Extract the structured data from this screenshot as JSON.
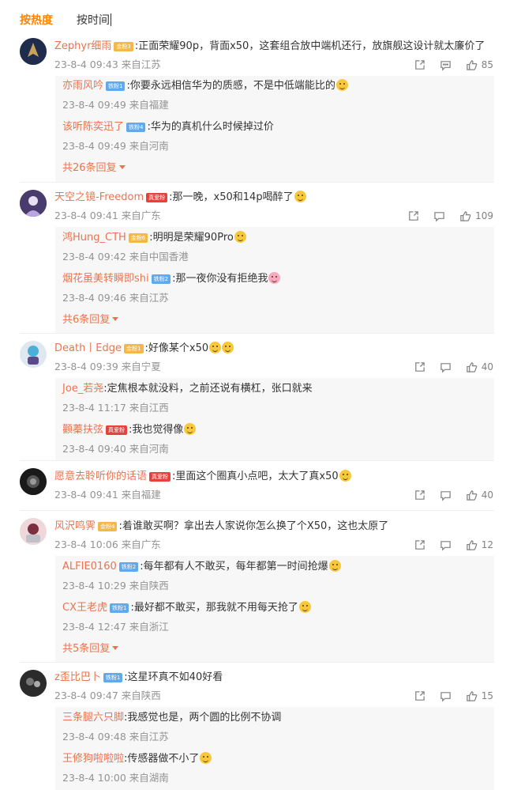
{
  "tabs": {
    "hot": "按热度",
    "time": "按时间"
  },
  "comments": [
    {
      "user": "Zephyr细雨",
      "badge": "金粉3",
      "badge_color": "#f6b74a",
      "text": ":正面荣耀90p，背面x50，这套组合放中端机还行，放旗舰这设计就太廉价了",
      "meta": "23-8-4 09:43 来自江苏",
      "likes": "85",
      "replies": [
        {
          "user": "亦雨风吟",
          "badge": "铁粉1",
          "text": ":你要永远相信华为的质感，不是中低端能比的",
          "meta": "23-8-4 09:49 来自福建"
        },
        {
          "user": "该听陈奕迅了",
          "badge": "铁粉4",
          "text": ":华为的真机什么时候掉过价",
          "meta": "23-8-4 09:49 来自河南"
        }
      ],
      "more": "共26条回复"
    },
    {
      "user": "天空之镜-Freedom",
      "badge": "真爱粉",
      "badge_color": "#e8413c",
      "text": ":那一晚，x50和14p喝醉了",
      "meta": "23-8-4 09:41 来自广东",
      "likes": "109",
      "replies": [
        {
          "user": "鸿Hung_CTH",
          "badge": "金粉6",
          "text": ":明明是荣耀90Pro",
          "meta": "23-8-4 09:42 来自中国香港"
        },
        {
          "user": "烟花虽美转瞬即shi",
          "badge": "铁粉2",
          "text": ":那一夜你没有拒绝我",
          "meta": "23-8-4 09:46 来自江苏"
        }
      ],
      "more": "共6条回复"
    },
    {
      "user": "Death丨Edge",
      "badge": "金粉1",
      "badge_color": "#f6b74a",
      "text": ":好像某个x50",
      "meta": "23-8-4 09:39 来自宁夏",
      "likes": "40",
      "replies": [
        {
          "user": "Joe_若尧",
          "badge": "",
          "text": ":定焦根本就没料，之前还说有横杠，张口就来",
          "meta": "23-8-4 11:17 来自江西"
        },
        {
          "user": "颧蓁扶弦",
          "badge": "真爱粉",
          "text": ":我也觉得像",
          "meta": "23-8-4 09:40 来自河南"
        }
      ],
      "more": ""
    },
    {
      "user": "愿意去聆听你的话语",
      "badge": "真爱粉",
      "badge_color": "#e8413c",
      "text": ":里面这个圈真小点吧，太大了真x50",
      "meta": "23-8-4 09:41 来自福建",
      "likes": "40",
      "replies": [],
      "more": ""
    },
    {
      "user": "风沢鸣霁",
      "badge": "金粉4",
      "badge_color": "#f6b74a",
      "text": ":着谁敢买啊？拿出去人家说你怎么换了个X50，这也太原了",
      "meta": "23-8-4 10:06 来自广东",
      "likes": "12",
      "replies": [
        {
          "user": "ALFIE0160",
          "badge": "铁粉2",
          "text": ":每年都有人不敢买，每年都第一时间抢爆",
          "meta": "23-8-4 10:29 来自陕西"
        },
        {
          "user": "CX王老虎",
          "badge": "铁粉1",
          "text": ":最好都不敢买，那我就不用每天抢了",
          "meta": "23-8-4 12:47 来自浙江"
        }
      ],
      "more": "共5条回复"
    },
    {
      "user": "z歪比巴卜",
      "badge": "铁粉1",
      "badge_color": "#5fa9ee",
      "text": ":这星环真不如40好看",
      "meta": "23-8-4 09:47 来自陕西",
      "likes": "15",
      "replies": [
        {
          "user": "三条腿六只脚",
          "badge": "",
          "text": ":我感觉也是，两个圆的比例不协调",
          "meta": "23-8-4 09:48 来自江苏"
        },
        {
          "user": "王修狗啦啦啦",
          "badge": "",
          "text": ":传感器做不小了",
          "meta": "23-8-4 10:00 来自湖南"
        }
      ],
      "more": ""
    }
  ]
}
